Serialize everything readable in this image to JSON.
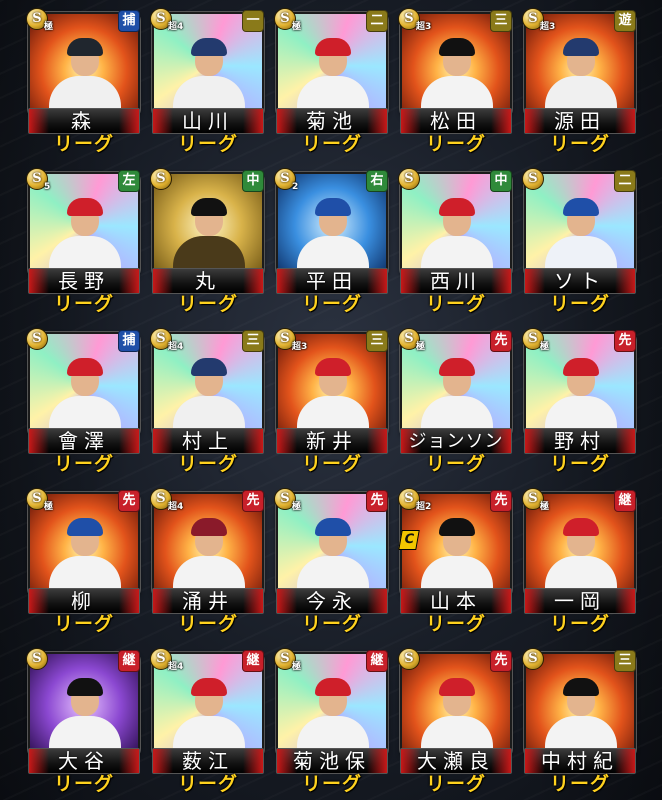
{
  "league_label": "リーグ",
  "cards": [
    {
      "name": "森",
      "pos": "捕",
      "pos_color": "#1f4fa8",
      "rank_sub": "極",
      "bg": "bg-fire",
      "cap": "#20262e",
      "uniform": "#f0f0f0"
    },
    {
      "name": "山川",
      "pos": "一",
      "pos_color": "#8a7a1a",
      "rank_sub": "超4",
      "bg": "bg-holo",
      "cap": "#233a6e",
      "uniform": "#f0f0f0"
    },
    {
      "name": "菊池",
      "pos": "二",
      "pos_color": "#8a7a1a",
      "rank_sub": "極",
      "bg": "bg-holo",
      "cap": "#cf1f2a",
      "uniform": "#f3f3f3"
    },
    {
      "name": "松田",
      "pos": "三",
      "pos_color": "#8a7a1a",
      "rank_sub": "超3",
      "bg": "bg-fire",
      "cap": "#111111",
      "uniform": "#f3f3f3"
    },
    {
      "name": "源田",
      "pos": "遊",
      "pos_color": "#8a7a1a",
      "rank_sub": "超3",
      "bg": "bg-fire",
      "cap": "#233a6e",
      "uniform": "#f0f0f0"
    },
    {
      "name": "長野",
      "pos": "左",
      "pos_color": "#2f8a3a",
      "rank_sub": "5",
      "bg": "bg-holo",
      "cap": "#cf1f2a",
      "uniform": "#f3f3f3"
    },
    {
      "name": "丸",
      "pos": "中",
      "pos_color": "#2f8a3a",
      "rank_sub": "",
      "bg": "bg-gold",
      "cap": "#111111",
      "uniform": "#4a3a1a"
    },
    {
      "name": "平田",
      "pos": "右",
      "pos_color": "#2f8a3a",
      "rank_sub": "2",
      "bg": "bg-blue",
      "cap": "#1f4fa8",
      "uniform": "#f3f3f3"
    },
    {
      "name": "西川",
      "pos": "中",
      "pos_color": "#2f8a3a",
      "rank_sub": "",
      "bg": "bg-holo",
      "cap": "#cf1f2a",
      "uniform": "#f3f3f3"
    },
    {
      "name": "ソト",
      "pos": "二",
      "pos_color": "#8a7a1a",
      "rank_sub": "",
      "bg": "bg-holo",
      "cap": "#1f4fa8",
      "uniform": "#eef2f8"
    },
    {
      "name": "會澤",
      "pos": "捕",
      "pos_color": "#1f4fa8",
      "rank_sub": "",
      "bg": "bg-holo",
      "cap": "#cf1f2a",
      "uniform": "#f3f3f3"
    },
    {
      "name": "村上",
      "pos": "三",
      "pos_color": "#8a7a1a",
      "rank_sub": "超4",
      "bg": "bg-holo",
      "cap": "#233a6e",
      "uniform": "#f0f0f0"
    },
    {
      "name": "新井",
      "pos": "三",
      "pos_color": "#8a7a1a",
      "rank_sub": "超3",
      "bg": "bg-fire",
      "cap": "#cf1f2a",
      "uniform": "#f3f3f3"
    },
    {
      "name": "ジョンソン",
      "pos": "先",
      "pos_color": "#c8202a",
      "rank_sub": "極",
      "bg": "bg-holo",
      "cap": "#cf1f2a",
      "uniform": "#f3f3f3"
    },
    {
      "name": "野村",
      "pos": "先",
      "pos_color": "#c8202a",
      "rank_sub": "極",
      "bg": "bg-holo",
      "cap": "#cf1f2a",
      "uniform": "#f3f3f3"
    },
    {
      "name": "柳",
      "pos": "先",
      "pos_color": "#c8202a",
      "rank_sub": "極",
      "bg": "bg-fire",
      "cap": "#1f4fa8",
      "uniform": "#f3f3f3"
    },
    {
      "name": "涌井",
      "pos": "先",
      "pos_color": "#c8202a",
      "rank_sub": "超4",
      "bg": "bg-fire",
      "cap": "#8a1a2a",
      "uniform": "#f3f3f3"
    },
    {
      "name": "今永",
      "pos": "先",
      "pos_color": "#c8202a",
      "rank_sub": "極",
      "bg": "bg-holo",
      "cap": "#1f4fa8",
      "uniform": "#f3f3f3"
    },
    {
      "name": "山本",
      "pos": "先",
      "pos_color": "#c8202a",
      "rank_sub": "超2",
      "bg": "bg-fire",
      "cap": "#111111",
      "uniform": "#f3f3f3"
    },
    {
      "name": "一岡",
      "pos": "継",
      "pos_color": "#c8202a",
      "rank_sub": "極",
      "bg": "bg-fire",
      "cap": "#cf1f2a",
      "uniform": "#f3f3f3"
    },
    {
      "name": "大谷",
      "pos": "継",
      "pos_color": "#c8202a",
      "rank_sub": "",
      "bg": "bg-purple",
      "cap": "#111111",
      "uniform": "#f3f3f3"
    },
    {
      "name": "薮江",
      "pos": "継",
      "pos_color": "#c8202a",
      "rank_sub": "超4",
      "bg": "bg-holo",
      "cap": "#cf1f2a",
      "uniform": "#f3f3f3"
    },
    {
      "name": "菊池保",
      "pos": "継",
      "pos_color": "#c8202a",
      "rank_sub": "極",
      "bg": "bg-holo",
      "cap": "#cf1f2a",
      "uniform": "#f3f3f3"
    },
    {
      "name": "大瀬良",
      "pos": "先",
      "pos_color": "#c8202a",
      "rank_sub": "",
      "bg": "bg-fire",
      "cap": "#cf1f2a",
      "uniform": "#f3f3f3"
    },
    {
      "name": "中村紀",
      "pos": "三",
      "pos_color": "#8a7a1a",
      "rank_sub": "",
      "bg": "bg-fire",
      "cap": "#111111",
      "uniform": "#f3f3f3"
    }
  ],
  "rank_letter": "S",
  "c_badge": "C",
  "c_badge_card_index": 18
}
